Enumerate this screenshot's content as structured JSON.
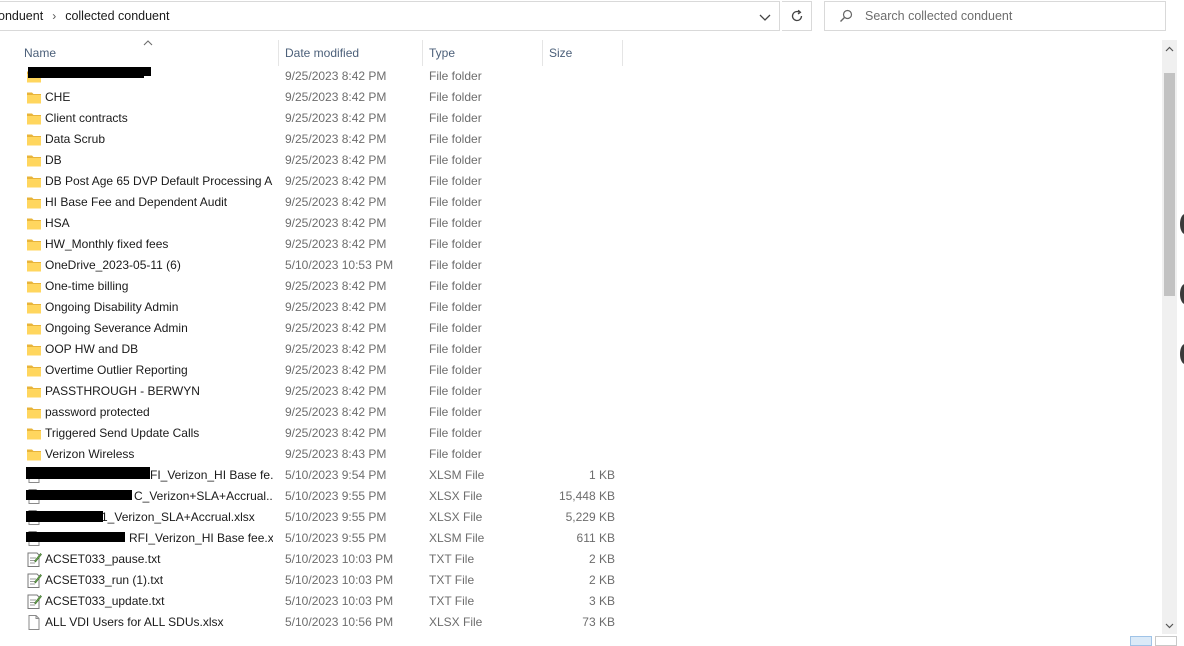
{
  "address": {
    "crumbs": [
      "onduent",
      "collected conduent"
    ]
  },
  "search": {
    "placeholder": "Search collected conduent"
  },
  "icons": {
    "refresh": "refresh-icon",
    "search": "search-icon",
    "dropdown": "chevron-down-icon"
  },
  "columns": {
    "name": "Name",
    "date": "Date modified",
    "type": "Type",
    "size": "Size"
  },
  "files": [
    {
      "name": "",
      "date": "9/25/2023 8:42 PM",
      "type": "File folder",
      "size": "",
      "icon": "folder"
    },
    {
      "name": "CHE",
      "date": "9/25/2023 8:42 PM",
      "type": "File folder",
      "size": "",
      "icon": "folder"
    },
    {
      "name": "Client contracts",
      "date": "9/25/2023 8:42 PM",
      "type": "File folder",
      "size": "",
      "icon": "folder"
    },
    {
      "name": "Data Scrub",
      "date": "9/25/2023 8:42 PM",
      "type": "File folder",
      "size": "",
      "icon": "folder"
    },
    {
      "name": "DB",
      "date": "9/25/2023 8:42 PM",
      "type": "File folder",
      "size": "",
      "icon": "folder"
    },
    {
      "name": "DB Post Age 65 DVP Default Processing A...",
      "date": "9/25/2023 8:42 PM",
      "type": "File folder",
      "size": "",
      "icon": "folder"
    },
    {
      "name": "HI Base Fee and Dependent Audit",
      "date": "9/25/2023 8:42 PM",
      "type": "File folder",
      "size": "",
      "icon": "folder"
    },
    {
      "name": "HSA",
      "date": "9/25/2023 8:42 PM",
      "type": "File folder",
      "size": "",
      "icon": "folder"
    },
    {
      "name": "HW_Monthly fixed fees",
      "date": "9/25/2023 8:42 PM",
      "type": "File folder",
      "size": "",
      "icon": "folder"
    },
    {
      "name": "OneDrive_2023-05-11 (6)",
      "date": "5/10/2023 10:53 PM",
      "type": "File folder",
      "size": "",
      "icon": "folder"
    },
    {
      "name": "One-time billing",
      "date": "9/25/2023 8:42 PM",
      "type": "File folder",
      "size": "",
      "icon": "folder"
    },
    {
      "name": "Ongoing Disability Admin",
      "date": "9/25/2023 8:42 PM",
      "type": "File folder",
      "size": "",
      "icon": "folder"
    },
    {
      "name": "Ongoing Severance Admin",
      "date": "9/25/2023 8:42 PM",
      "type": "File folder",
      "size": "",
      "icon": "folder"
    },
    {
      "name": "OOP HW and DB",
      "date": "9/25/2023 8:42 PM",
      "type": "File folder",
      "size": "",
      "icon": "folder"
    },
    {
      "name": "Overtime Outlier Reporting",
      "date": "9/25/2023 8:42 PM",
      "type": "File folder",
      "size": "",
      "icon": "folder"
    },
    {
      "name": "PASSTHROUGH - BERWYN",
      "date": "9/25/2023 8:42 PM",
      "type": "File folder",
      "size": "",
      "icon": "folder"
    },
    {
      "name": "password protected",
      "date": "9/25/2023 8:42 PM",
      "type": "File folder",
      "size": "",
      "icon": "folder"
    },
    {
      "name": "Triggered Send Update Calls",
      "date": "9/25/2023 8:42 PM",
      "type": "File folder",
      "size": "",
      "icon": "folder"
    },
    {
      "name": "Verizon Wireless",
      "date": "9/25/2023 8:43 PM",
      "type": "File folder",
      "size": "",
      "icon": "folder"
    },
    {
      "name": "FI_Verizon_HI Base fe...",
      "date": "5/10/2023 9:54 PM",
      "type": "XLSM File",
      "size": "1 KB",
      "icon": "document"
    },
    {
      "name": "C_Verizon+SLA+Accrual....",
      "date": "5/10/2023 9:55 PM",
      "type": "XLSX File",
      "size": "15,448 KB",
      "icon": "document"
    },
    {
      "name": "1_Verizon_SLA+Accrual.xlsx",
      "date": "5/10/2023 9:55 PM",
      "type": "XLSX File",
      "size": "5,229 KB",
      "icon": "document"
    },
    {
      "name": "RFI_Verizon_HI Base fee.x...",
      "date": "5/10/2023 9:55 PM",
      "type": "XLSM File",
      "size": "611 KB",
      "icon": "document"
    },
    {
      "name": "ACSET033_pause.txt",
      "date": "5/10/2023 10:03 PM",
      "type": "TXT File",
      "size": "2 KB",
      "icon": "text-file"
    },
    {
      "name": "ACSET033_run (1).txt",
      "date": "5/10/2023 10:03 PM",
      "type": "TXT File",
      "size": "2 KB",
      "icon": "text-file"
    },
    {
      "name": "ACSET033_update.txt",
      "date": "5/10/2023 10:03 PM",
      "type": "TXT File",
      "size": "3 KB",
      "icon": "text-file"
    },
    {
      "name": "ALL VDI Users for ALL SDUs.xlsx",
      "date": "5/10/2023 10:56 PM",
      "type": "XLSX File",
      "size": "73 KB",
      "icon": "document"
    }
  ]
}
